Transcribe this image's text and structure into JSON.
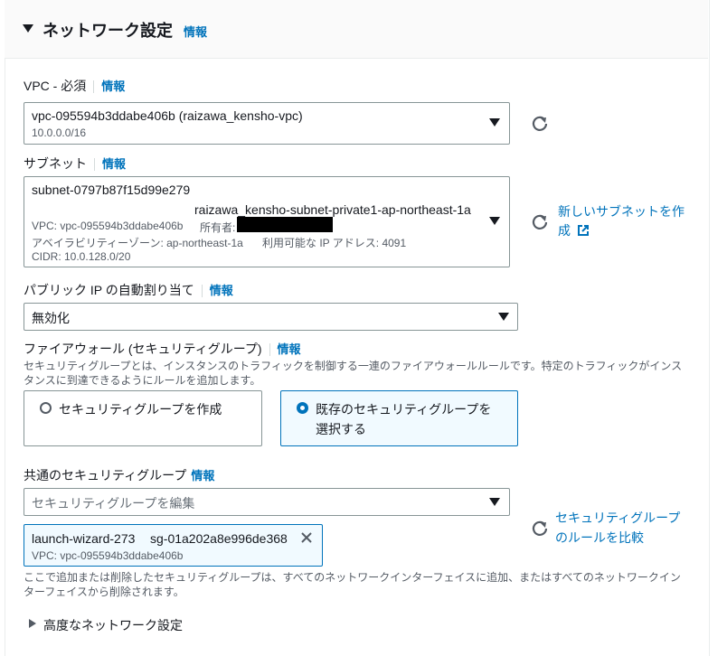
{
  "section": {
    "title": "ネットワーク設定",
    "info": "情報"
  },
  "vpc": {
    "label": "VPC - 必須",
    "info": "情報",
    "value": "vpc-095594b3ddabe406b (raizawa_kensho-vpc)",
    "cidr": "10.0.0.0/16"
  },
  "subnet": {
    "label": "サブネット",
    "info": "情報",
    "id": "subnet-0797b87f15d99e279",
    "name": "raizawa_kensho-subnet-private1-ap-northeast-1a",
    "vpc_line": "VPC: vpc-095594b3ddabe406b",
    "owner_label": "所有者:",
    "az_line": "アベイラビリティーゾーン: ap-northeast-1a",
    "ip_line": "利用可能な IP アドレス: 4091",
    "cidr_line": "CIDR: 10.0.128.0/20",
    "create_link": "新しいサブネットを作成"
  },
  "public_ip": {
    "label": "パブリック IP の自動割り当て",
    "info": "情報",
    "value": "無効化"
  },
  "firewall": {
    "label": "ファイアウォール (セキュリティグループ)",
    "info": "情報",
    "desc1": "セキュリティグループとは、インスタンスのトラフィックを制御する一連のファイアウォールルールです。特定のトラフィックがインス",
    "desc2": "タンスに到達できるようにルールを追加します。",
    "option_create": "セキュリティグループを作成",
    "option_existing_1": "既存のセキュリティグループを",
    "option_existing_2": "選択する",
    "selected": "existing"
  },
  "common_sg": {
    "label": "共通のセキュリティグループ",
    "info": "情報",
    "placeholder": "セキュリティグループを編集",
    "token_name": "launch-wizard-273",
    "token_id": "sg-01a202a8e996de368",
    "token_vpc": "VPC: vpc-095594b3ddabe406b",
    "compare_link_1": "セキュリティグループ",
    "compare_link_2": "のルールを比較",
    "note1": "ここで追加または削除したセキュリティグループは、すべてのネットワークインターフェイスに追加、またはすべてのネットワークイン",
    "note2": "ターフェイスから削除されます。"
  },
  "advanced": {
    "label": "高度なネットワーク設定"
  },
  "colors": {
    "link": "#0073bb",
    "border": "#879596",
    "selected_bg": "#f1faff"
  }
}
